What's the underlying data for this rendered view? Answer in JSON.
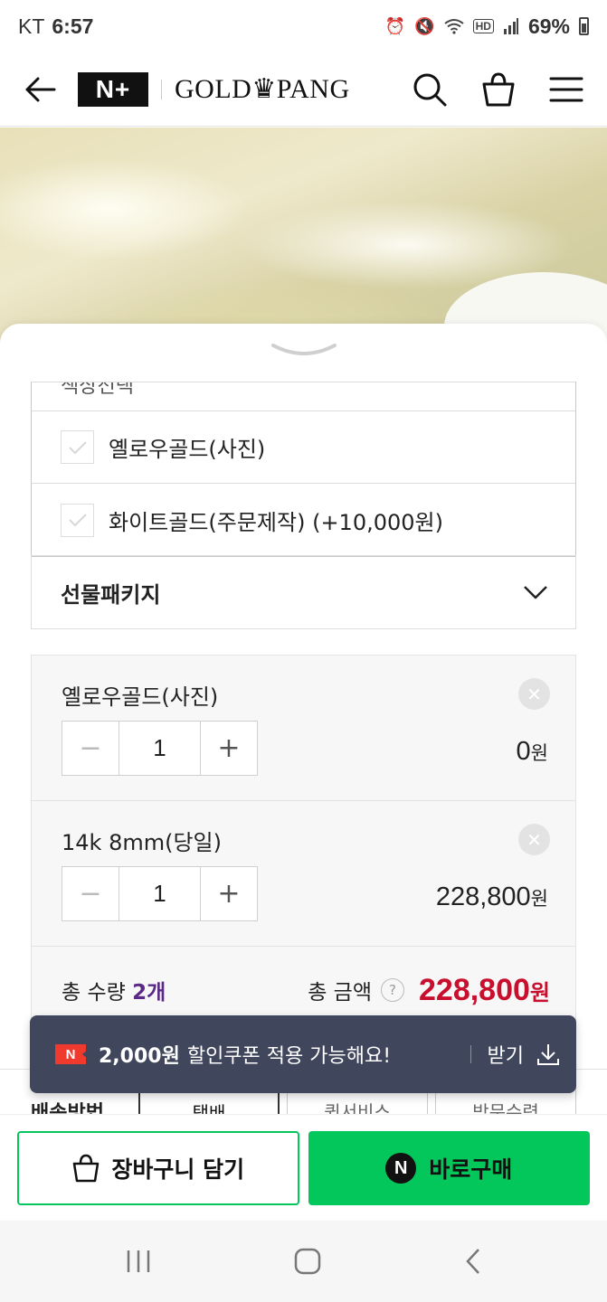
{
  "status_bar": {
    "carrier": "KT",
    "time": "6:57",
    "battery": "69%"
  },
  "header": {
    "badge": "N+",
    "brand": "GOLD♛PANG"
  },
  "options": {
    "partial_top": "색상선택",
    "items": [
      {
        "label": "옐로우골드(사진)"
      },
      {
        "label": "화이트골드(주문제작) (+10,000원)"
      }
    ]
  },
  "gift_package": {
    "label": "선물패키지"
  },
  "cart": {
    "items": [
      {
        "name": "옐로우골드(사진)",
        "qty": "1",
        "price": "0",
        "unit": "원"
      },
      {
        "name": "14k 8mm(당일)",
        "qty": "1",
        "price": "228,800",
        "unit": "원"
      }
    ],
    "total_qty_label": "총 수량",
    "total_qty": "2개",
    "total_amount_label": "총 금액",
    "total_amount": "228,800",
    "total_unit": "원"
  },
  "toast": {
    "icon": "N",
    "amount": "2,000원",
    "message": "할인쿠폰 적용 가능해요!",
    "action": "받기"
  },
  "delivery": {
    "label": "배송방법",
    "tabs": [
      "택배",
      "퀵서비스",
      "방문수령"
    ]
  },
  "actions": {
    "cart_label": "장바구니 담기",
    "buy_icon": "N",
    "buy_label": "바로구매"
  },
  "colors": {
    "accent_green": "#03c75a",
    "price_red": "#c8102e",
    "toast_bg": "#40465c",
    "qty_purple": "#5b2a86"
  }
}
